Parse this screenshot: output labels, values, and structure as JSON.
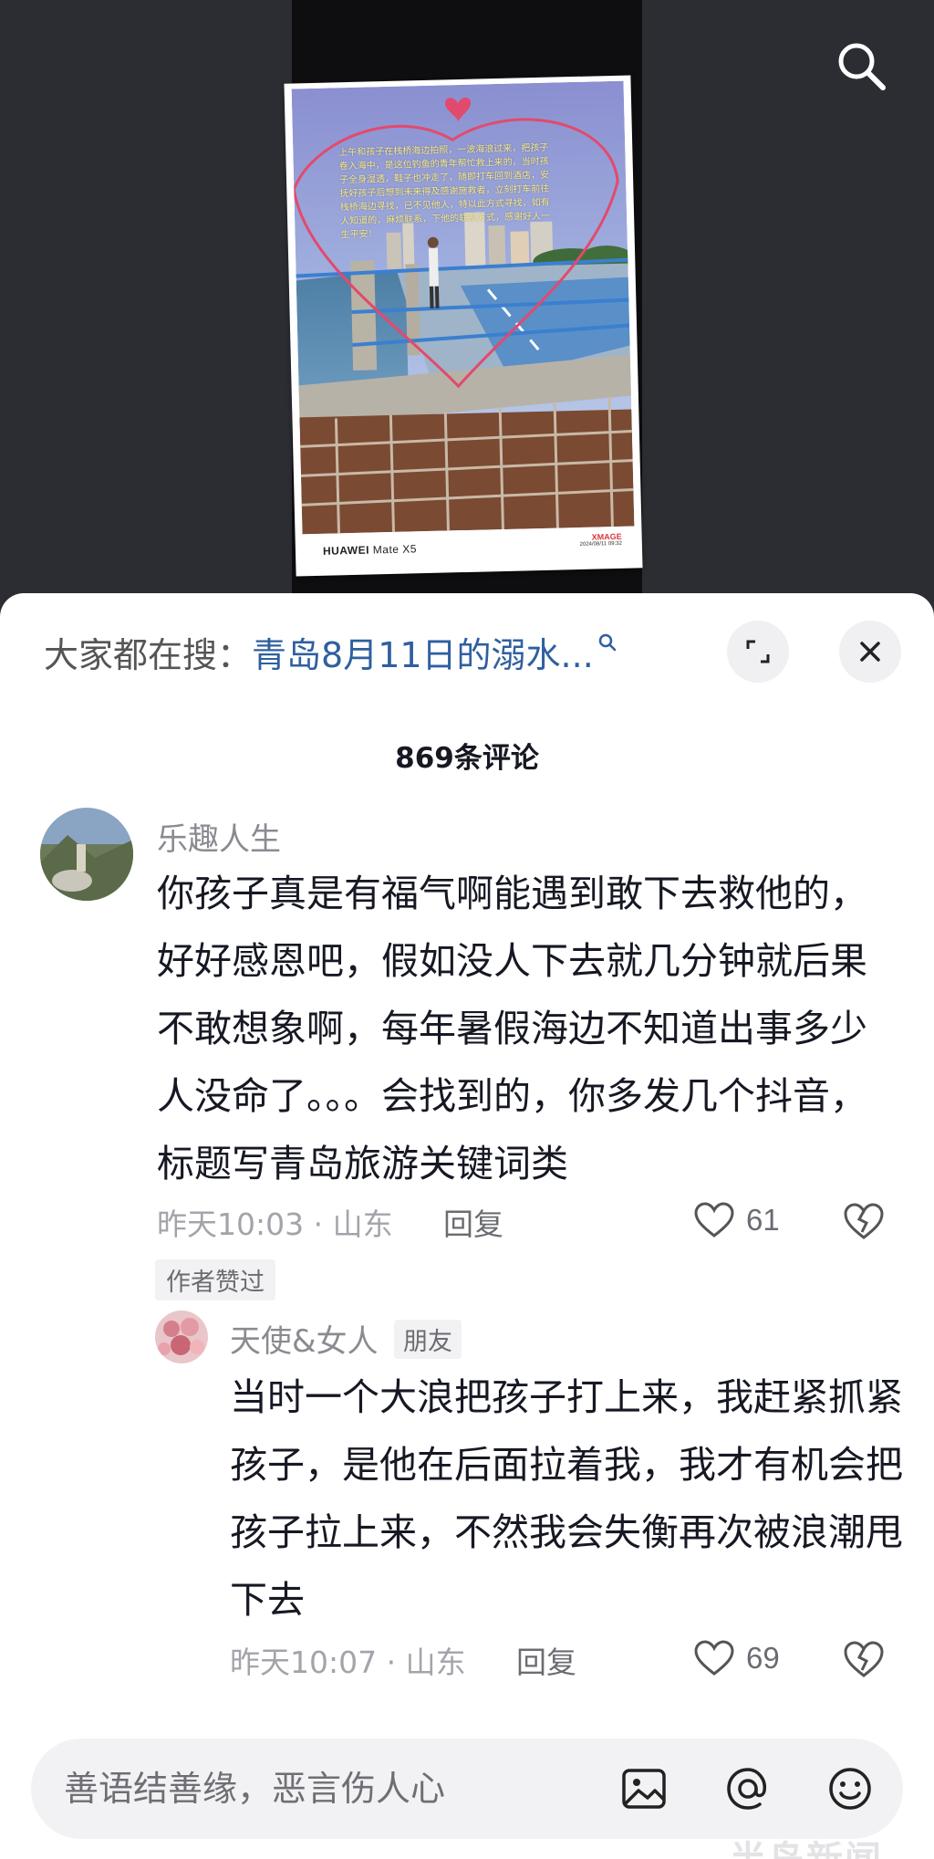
{
  "video": {
    "caption": "上午和孩子在栈桥海边拍照，一波海浪过来，把孩子卷入海中，是这位钓鱼的青年帮忙救上来的，当时孩子全身湿透，鞋子也冲走了，随即打车回到酒店，安抚好孩子后想到未来得及感谢施救者，立刻打车前往栈桥海边寻找，已不见他人，特以此方式寻找，如有人知道的，麻烦联系，下他的联系方式，感谢好人一生平安！",
    "camera_brand": "HUAWEI",
    "camera_model": "Mate X5",
    "xmage": "XMAGE",
    "photo_date": "2024/08/11  09:32",
    "search_icon": "search-icon"
  },
  "sheet": {
    "hot_search_label": "大家都在搜：",
    "hot_search_query": "青岛8月11日的溺水...",
    "comment_count": "869条评论"
  },
  "comments": [
    {
      "username": "乐趣人生",
      "text": "你孩子真是有福气啊能遇到敢下去救他的，好好感恩吧，假如没人下去就几分钟就后果不敢想象啊，每年暑假海边不知道出事多少人没命了。。。会找到的，你多发几个抖音，标题写青岛旅游关键词类",
      "meta": "昨天10:03 · 山东",
      "reply_label": "回复",
      "likes": "61",
      "author_liked": "作者赞过"
    }
  ],
  "reply": {
    "username": "天使&女人",
    "tag": "朋友",
    "text": "当时一个大浪把孩子打上来，我赶紧抓紧孩子，是他在后面拉着我，我才有机会把孩子拉上来，不然我会失衡再次被浪潮甩下去",
    "meta": "昨天10:07 · 山东",
    "reply_label": "回复",
    "likes": "69"
  },
  "input": {
    "placeholder": "善语结善缘，恶言伤人心",
    "icons": [
      "image-icon",
      "at-icon",
      "emoji-icon"
    ]
  },
  "watermark": "半岛新闻",
  "colors": {
    "link_blue": "#2f5f9f",
    "text_dark": "#161823",
    "text_gray": "#a3a4aa",
    "sheet_bg": "#ffffff",
    "dark_bg": "#2b2d33"
  }
}
